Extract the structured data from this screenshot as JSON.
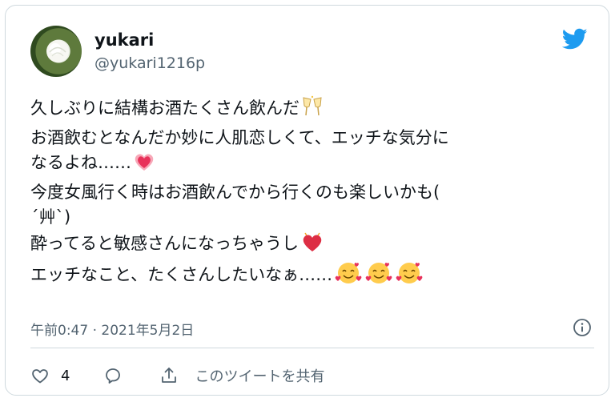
{
  "author": {
    "display_name": "yukari",
    "handle": "@yukari1216p",
    "avatar_icon": "rose-avatar"
  },
  "brand": {
    "icon": "twitter-bird-icon",
    "color": "#1d9bf0"
  },
  "tweet": {
    "lines": [
      "久しぶりに結構お酒たくさん飲んだ",
      "お酒飲むとなんだか妙に人肌恋しくて、エッチな気分に",
      "なるよね……",
      "今度女風行く時はお酒飲んでから行くのも楽しいかも(",
      "´艸`)",
      "酔ってると敏感さんになっちゃうし",
      "エッチなこと、たくさんしたいなぁ……"
    ],
    "emojis": {
      "line1": "clinking-glasses-emoji",
      "line3": "growing-heart-emoji",
      "line6": "heart-emoji",
      "line7": "smiling-face-with-hearts-emoji"
    }
  },
  "timestamp": "午前0:47 · 2021年5月2日",
  "actions": {
    "like_count": "4",
    "share_label": "このツイートを共有"
  },
  "colors": {
    "text": "#0f1419",
    "secondary": "#536471",
    "border": "#cfd9de",
    "heart": "#e0245e"
  }
}
